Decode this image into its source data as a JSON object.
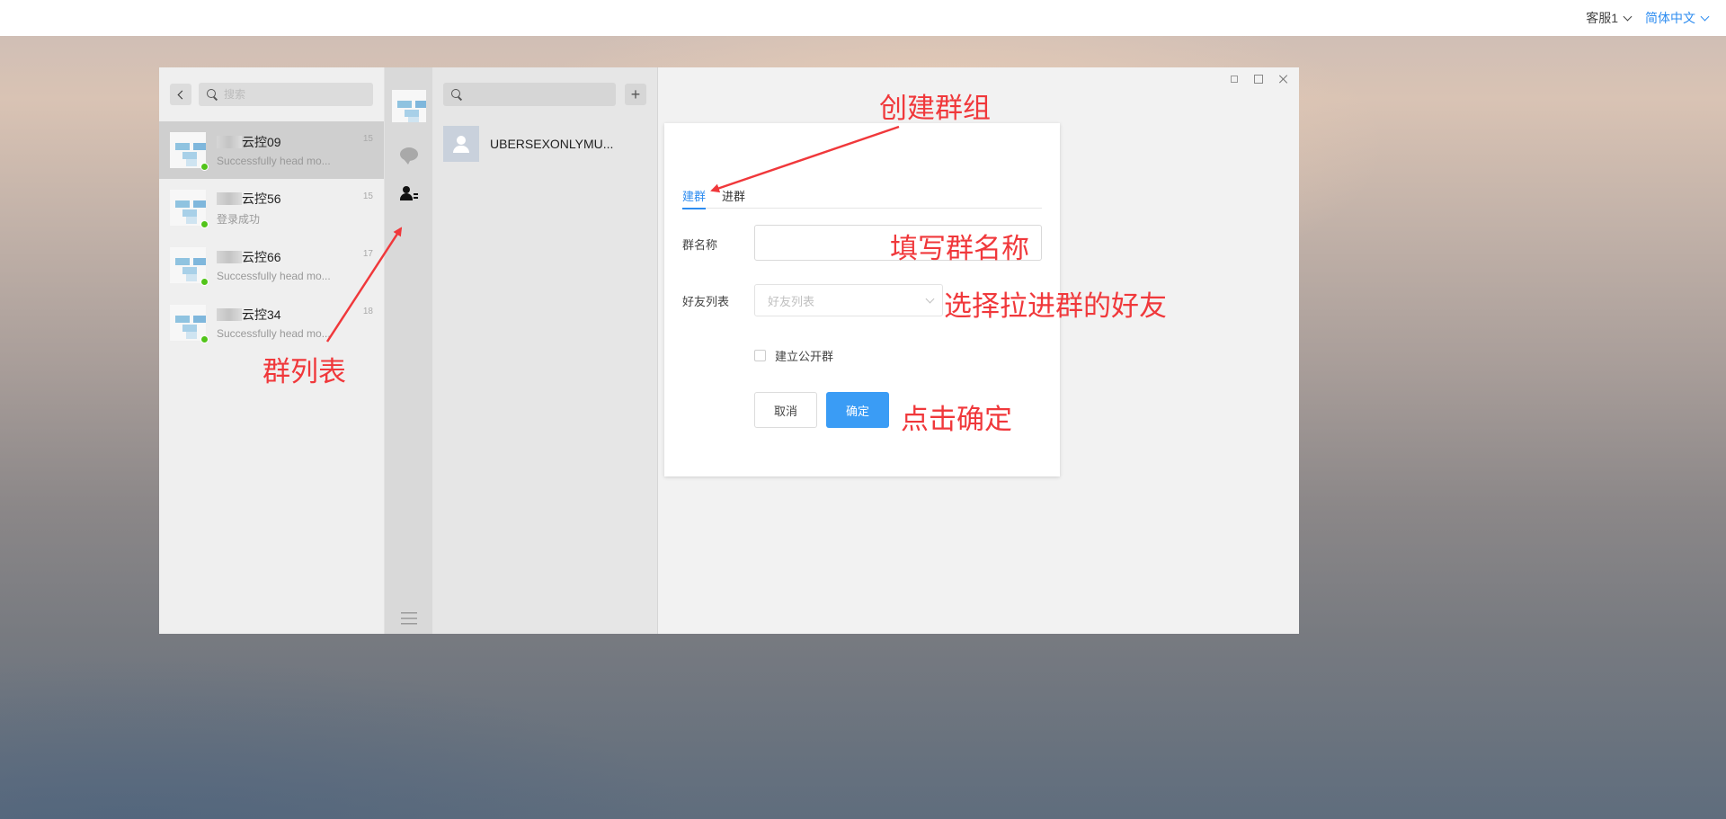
{
  "topbar": {
    "user": "客服1",
    "language": "简体中文"
  },
  "left_panel": {
    "search_placeholder": "搜索",
    "chats": [
      {
        "name": "云控09",
        "preview": "Successfully head mo...",
        "time": "15"
      },
      {
        "name": "云控56",
        "preview": "登录成功",
        "time": "15"
      },
      {
        "name": "云控66",
        "preview": "Successfully head mo...",
        "time": "17"
      },
      {
        "name": "云控34",
        "preview": "Successfully head mo...",
        "time": "18"
      }
    ]
  },
  "contacts_panel": {
    "add_label": "+",
    "contacts": [
      {
        "name": "UBERSEXONLYMU..."
      }
    ]
  },
  "create_group": {
    "tab_create": "建群",
    "tab_join": "进群",
    "group_name_label": "群名称",
    "friends_label": "好友列表",
    "friends_placeholder": "好友列表",
    "public_group_label": "建立公开群",
    "cancel_label": "取消",
    "confirm_label": "确定"
  },
  "annotations": {
    "create_group": "创建群组",
    "fill_name": "填写群名称",
    "select_friends": "选择拉进群的好友",
    "group_list": "群列表",
    "click_confirm": "点击确定"
  },
  "colors": {
    "accent": "#2d8cf0",
    "annotation": "#f0383b",
    "online": "#52c41a"
  }
}
